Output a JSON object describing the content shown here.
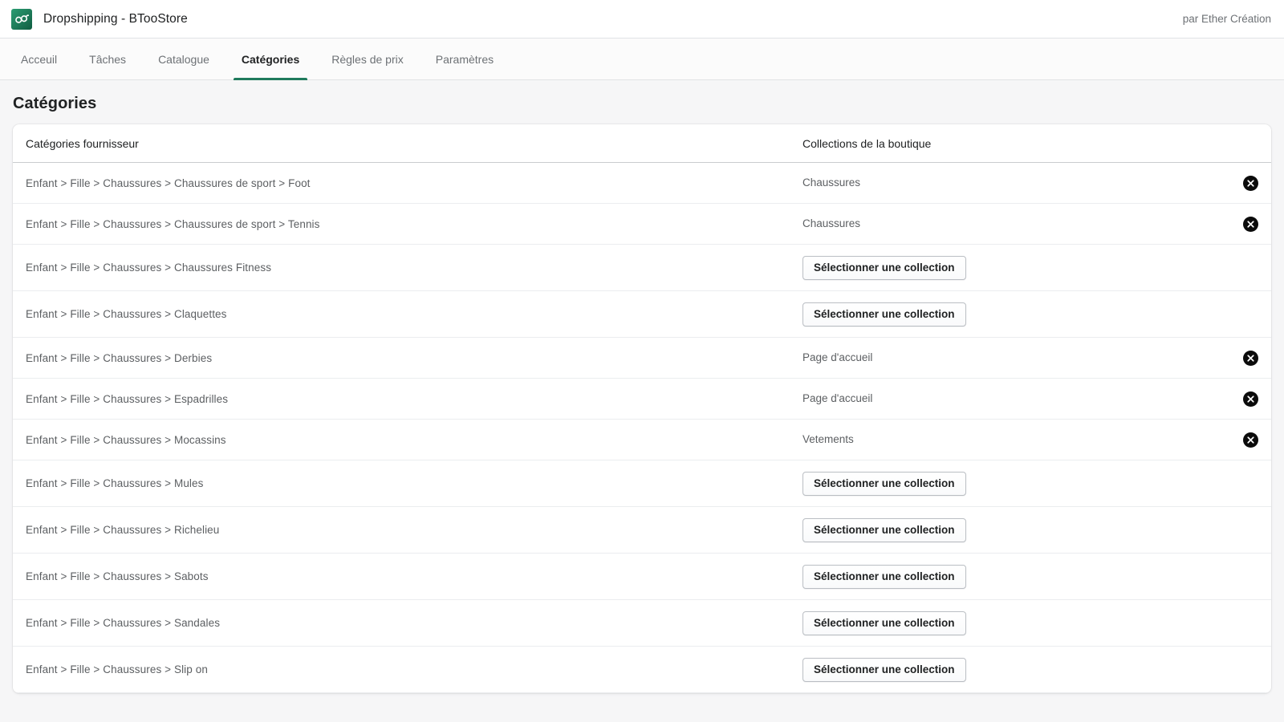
{
  "topbar": {
    "logo_icon": "infinity-logo-icon",
    "app_title": "Dropshipping - BTooStore",
    "credit": "par Ether Création"
  },
  "nav": {
    "tabs": [
      {
        "label": "Acceuil",
        "active": false
      },
      {
        "label": "Tâches",
        "active": false
      },
      {
        "label": "Catalogue",
        "active": false
      },
      {
        "label": "Catégories",
        "active": true
      },
      {
        "label": "Règles de prix",
        "active": false
      },
      {
        "label": "Paramètres",
        "active": false
      }
    ],
    "accent_color": "#1f7a5c"
  },
  "page": {
    "title": "Catégories"
  },
  "table": {
    "headers": {
      "supplier": "Catégories fournisseur",
      "collection": "Collections de la boutique"
    },
    "select_button_label": "Sélectionner une collection",
    "remove_icon": "circle-x-icon",
    "rows": [
      {
        "path": "Enfant > Fille > Chaussures > Chaussures de sport > Foot",
        "collection": "Chaussures",
        "has_collection": true
      },
      {
        "path": "Enfant > Fille > Chaussures > Chaussures de sport > Tennis",
        "collection": "Chaussures",
        "has_collection": true
      },
      {
        "path": "Enfant > Fille > Chaussures > Chaussures Fitness",
        "collection": "",
        "has_collection": false
      },
      {
        "path": "Enfant > Fille > Chaussures > Claquettes",
        "collection": "",
        "has_collection": false
      },
      {
        "path": "Enfant > Fille > Chaussures > Derbies",
        "collection": "Page d'accueil",
        "has_collection": true
      },
      {
        "path": "Enfant > Fille > Chaussures > Espadrilles",
        "collection": "Page d'accueil",
        "has_collection": true
      },
      {
        "path": "Enfant > Fille > Chaussures > Mocassins",
        "collection": "Vetements",
        "has_collection": true
      },
      {
        "path": "Enfant > Fille > Chaussures > Mules",
        "collection": "",
        "has_collection": false
      },
      {
        "path": "Enfant > Fille > Chaussures > Richelieu",
        "collection": "",
        "has_collection": false
      },
      {
        "path": "Enfant > Fille > Chaussures > Sabots",
        "collection": "",
        "has_collection": false
      },
      {
        "path": "Enfant > Fille > Chaussures > Sandales",
        "collection": "",
        "has_collection": false
      },
      {
        "path": "Enfant > Fille > Chaussures > Slip on",
        "collection": "",
        "has_collection": false
      }
    ]
  }
}
